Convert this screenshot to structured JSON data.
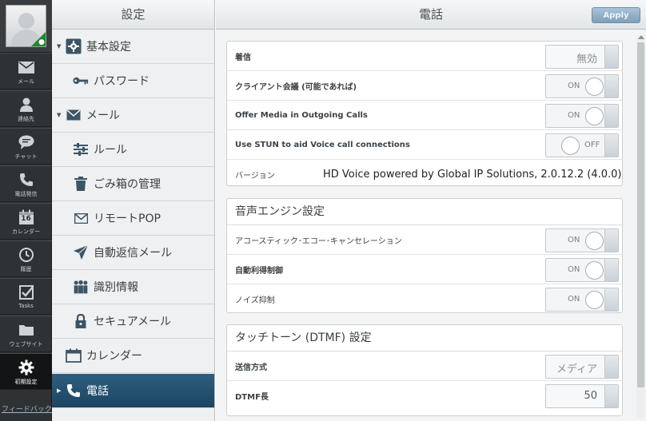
{
  "rail": {
    "items": [
      {
        "label": "メール",
        "icon": "envelope-icon"
      },
      {
        "label": "連絡先",
        "icon": "person-icon"
      },
      {
        "label": "チャット",
        "icon": "chat-bubble-icon"
      },
      {
        "label": "電話発信",
        "icon": "phone-icon"
      },
      {
        "label": "カレンダー",
        "icon": "calendar-icon",
        "calendar_day": "16"
      },
      {
        "label": "履歴",
        "icon": "clock-icon"
      },
      {
        "label": "Tasks",
        "icon": "checkbox-icon"
      },
      {
        "label": "ウェブサイト",
        "icon": "folder-icon"
      },
      {
        "label": "初期設定",
        "icon": "gear-icon",
        "active": true
      }
    ],
    "feedback": "フィードバック"
  },
  "nav": {
    "title": "設定",
    "items": [
      {
        "label": "基本設定",
        "icon": "general-settings-icon",
        "expanded": true
      },
      {
        "label": "パスワード",
        "icon": "key-icon"
      },
      {
        "label": "メール",
        "icon": "envelope-icon",
        "expanded": true
      },
      {
        "label": "ルール",
        "icon": "sliders-icon"
      },
      {
        "label": "ごみ箱の管理",
        "icon": "trash-icon"
      },
      {
        "label": "リモートPOP",
        "icon": "envelope-small-icon"
      },
      {
        "label": "自動返信メール",
        "icon": "airplane-icon"
      },
      {
        "label": "識別情報",
        "icon": "people-icon"
      },
      {
        "label": "セキュアメール",
        "icon": "lock-icon"
      },
      {
        "label": "カレンダー",
        "icon": "calendar-icon"
      },
      {
        "label": "電話",
        "icon": "phone-icon",
        "active": true
      }
    ]
  },
  "main": {
    "title": "電話",
    "apply_label": "Apply",
    "phone_section": {
      "rows": [
        {
          "label": "着信",
          "control": "select",
          "value": "無効"
        },
        {
          "label": "クライアント会議 (可能であれば)",
          "control": "toggle",
          "state": "ON"
        },
        {
          "label": "Offer Media in Outgoing Calls",
          "control": "toggle",
          "state": "ON"
        },
        {
          "label": "Use STUN to aid Voice call connections",
          "control": "toggle",
          "state": "OFF"
        },
        {
          "label": "バージョン",
          "control": "text",
          "value": "HD Voice powered by Global IP Solutions, 2.0.12.2 (4.0.0)"
        }
      ]
    },
    "audio_section": {
      "title": "音声エンジン設定",
      "rows": [
        {
          "label": "アコースティック･エコー･キャンセレーション",
          "state": "ON"
        },
        {
          "label": "自動利得制御",
          "state": "ON"
        },
        {
          "label": "ノイズ抑制",
          "state": "ON"
        }
      ]
    },
    "dtmf_section": {
      "title": "タッチトーン (DTMF) 設定",
      "rows": [
        {
          "label": "送信方式",
          "value": "メディア"
        },
        {
          "label": "DTMF長",
          "value": "50"
        }
      ]
    }
  },
  "colors": {
    "rail_bg": "#2f3234",
    "nav_active": "#1b4563",
    "apply_button": "#8eabc5"
  }
}
